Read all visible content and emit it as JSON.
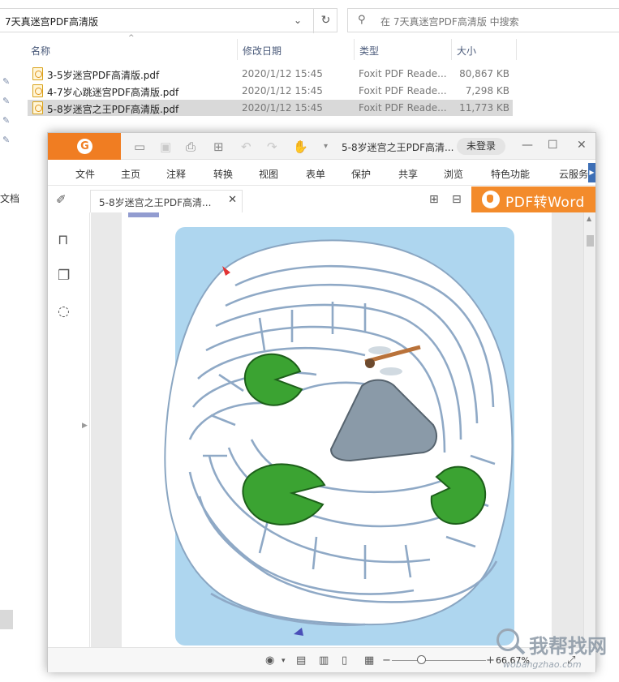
{
  "explorer": {
    "address": "7天真迷宫PDF高清版",
    "search_placeholder": "在 7天真迷宫PDF高清版 中搜索",
    "left_partial_text": "文档",
    "columns": {
      "name": "名称",
      "date": "修改日期",
      "type": "类型",
      "size": "大小"
    },
    "files": [
      {
        "name": "3-5岁迷宫PDF高清版.pdf",
        "date": "2020/1/12 15:45",
        "type": "Foxit PDF Reade...",
        "size": "80,867 KB",
        "selected": false
      },
      {
        "name": "4-7岁心跳迷宫PDF高清版.pdf",
        "date": "2020/1/12 15:45",
        "type": "Foxit PDF Reade...",
        "size": "7,298 KB",
        "selected": false
      },
      {
        "name": "5-8岁迷宫之王PDF高清版.pdf",
        "date": "2020/1/12 15:45",
        "type": "Foxit PDF Reade...",
        "size": "11,773 KB",
        "selected": true
      }
    ]
  },
  "foxit": {
    "title": "5-8岁迷宫之王PDF高清...",
    "login": "未登录",
    "menus": [
      "文件",
      "主页",
      "注释",
      "转换",
      "视图",
      "表单",
      "保护",
      "共享",
      "浏览",
      "特色功能",
      "云服务"
    ],
    "tab_label": "5-8岁迷宫之王PDF高清...",
    "pdf_to_word": "PDF转Word",
    "zoom": "66.67%",
    "accent": "#f07d22"
  },
  "watermark": {
    "title": "我帮找网",
    "url": "wobangzhao.com"
  }
}
